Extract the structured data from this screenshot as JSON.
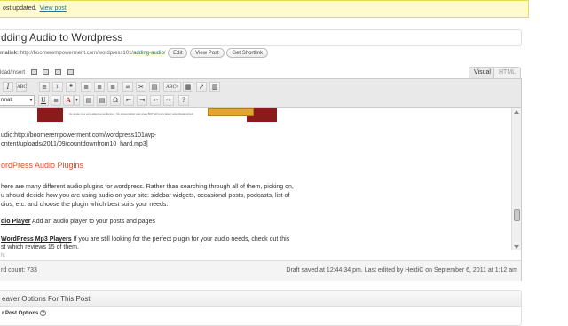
{
  "notice": {
    "text": "ost updated.",
    "link": "View post"
  },
  "post": {
    "title": "dding Audio to Wordpress",
    "permalink_label": "malink:",
    "permalink_base": "http://boomerempowerment.com/wordpress101/",
    "permalink_slug": "adding-audio",
    "permalink_end": "/",
    "buttons": [
      "Edit",
      "View Post",
      "Get Shortlink"
    ]
  },
  "upload": {
    "label": "load/Insert",
    "icons": [
      "image-icon",
      "video-icon",
      "music-icon",
      "media-icon"
    ]
  },
  "editor_tabs": {
    "visual": "Visual",
    "html": "HTML"
  },
  "toolbar": {
    "row1": [
      "I",
      "ABC",
      "≡",
      "1.",
      "❝",
      "≣",
      "≣",
      "≣",
      "∞",
      "✂",
      "▤",
      "ABC▾",
      "▦",
      "⤢",
      "▥"
    ],
    "format_value": "rmat",
    "row2": [
      "U",
      "≣",
      "A",
      "▾",
      "▤",
      "▤",
      "Ω",
      "⇤",
      "⇥",
      "↶",
      "↷",
      "?"
    ]
  },
  "content": {
    "image_caption": "he spoke to a very attentive audience... his presentation was great BUT all hours later I was disappointed.",
    "url_line1": "udio:http://boomerempowerment.com/wordpress101/wp-",
    "url_line2": "ontent/uploads/2011/09/countdownfrom10_hard.mp3]",
    "heading": "ordPress Audio Plugins",
    "para_l1": "here are many different audio plugins for wordpress. Rather than searching through all of them, picking on,",
    "para_l2": "u should decide how you are using audio on your site: sidebar widgets, occasional posts, podcasts, list of",
    "para_l3": "dios, etc. and choose the plugin which best suits your needs.",
    "plugin1_link": "dio Player",
    "plugin1_desc": "  Add an audio player to your posts and pages",
    "plugin2_link": "WordPress Mp3 Players",
    "plugin2_desc": "  If you are still looking for the perfect plugin for your audio needs, check out this",
    "plugin2_l2": "st which reviews 15 of them."
  },
  "statusbar": {
    "path": "h:"
  },
  "wordbar": {
    "count": "rd count: 733",
    "saved": "Draft saved at 12:44:34 pm. Last edited by HeidiC on September 6, 2011 at 1:12 am"
  },
  "metabox": {
    "title": "eaver Options For This Post",
    "sub": "r Post Options",
    "help": "?"
  }
}
